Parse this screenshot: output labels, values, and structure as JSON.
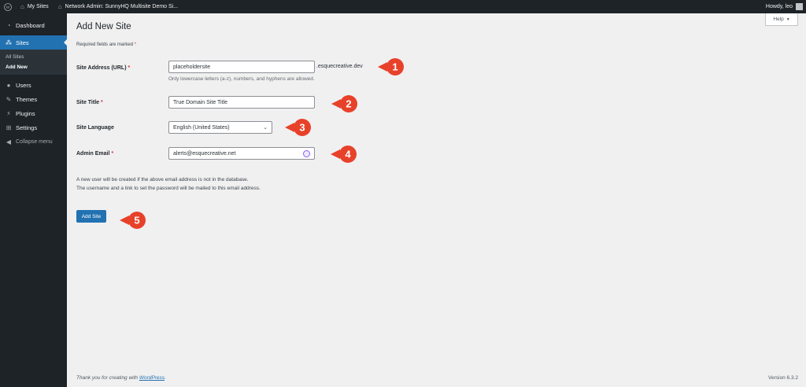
{
  "adminbar": {
    "my_sites": "My Sites",
    "network_admin": "Network Admin: SunnyHQ Multisite Demo Si...",
    "howdy": "Howdy, leo"
  },
  "sidebar": {
    "items": [
      {
        "label": "Dashboard",
        "icon": "dashboard-icon"
      },
      {
        "label": "Sites",
        "icon": "sites-icon"
      },
      {
        "label": "Users",
        "icon": "users-icon"
      },
      {
        "label": "Themes",
        "icon": "themes-icon"
      },
      {
        "label": "Plugins",
        "icon": "plugins-icon"
      },
      {
        "label": "Settings",
        "icon": "settings-icon"
      },
      {
        "label": "Collapse menu",
        "icon": "collapse-icon"
      }
    ],
    "submenu": [
      "All Sites",
      "Add New"
    ]
  },
  "help": {
    "label": "Help",
    "chevron": "▼"
  },
  "page": {
    "title": "Add New Site",
    "required_note": "Required fields are marked",
    "required_star": "*"
  },
  "form": {
    "site_address": {
      "label": "Site Address (URL)",
      "value": "placeholdersite",
      "suffix": ".esquecreative.dev",
      "hint": "Only lowercase letters (a-z), numbers, and hyphens are allowed."
    },
    "site_title": {
      "label": "Site Title",
      "value": "True Domain Site Title"
    },
    "site_language": {
      "label": "Site Language",
      "value": "English (United States)"
    },
    "admin_email": {
      "label": "Admin Email",
      "value": "alerts@esquecreative.net"
    },
    "info_line_1": "A new user will be created if the above email address is not in the database.",
    "info_line_2": "The username and a link to set the password will be mailed to this email address.",
    "submit_label": "Add Site"
  },
  "callouts": [
    "1",
    "2",
    "3",
    "4",
    "5"
  ],
  "colors": {
    "callout": "#e8412a",
    "primary": "#2271b1",
    "adminbar": "#1d2327",
    "required": "#d63638"
  },
  "footer": {
    "thanks_prefix": "Thank you for creating with",
    "wordpress_link": "WordPress",
    "thanks_suffix": ".",
    "version": "Version 6.3.2"
  }
}
